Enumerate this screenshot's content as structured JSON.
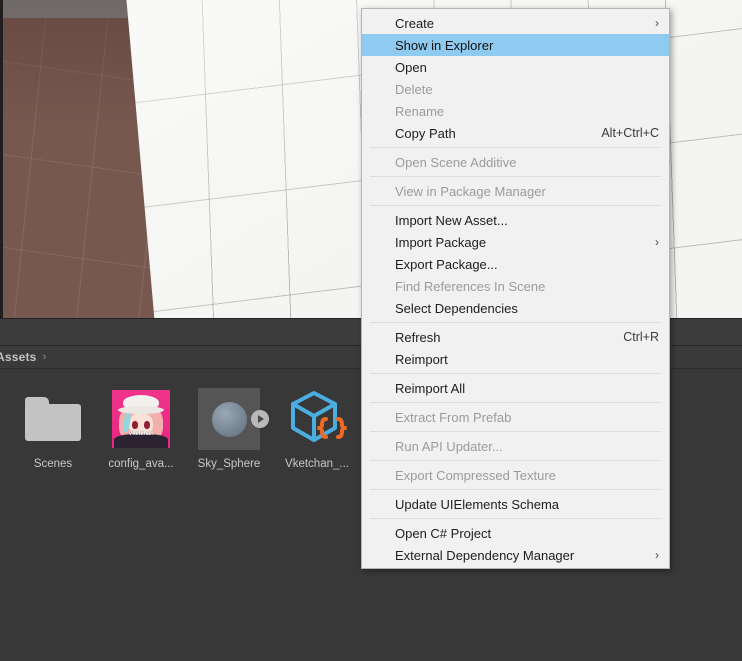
{
  "scene_view": {
    "name": "scene-viewport",
    "ground_color": "#77584f",
    "plane_color": "#f4f4f2",
    "sky_color": "#6e6a68"
  },
  "project_window": {
    "breadcrumb": {
      "root_label": "Assets",
      "chevron": "›"
    },
    "assets": [
      {
        "label": "Scenes",
        "icon": "folder-icon"
      },
      {
        "label": "config_ava...",
        "icon": "avatar-thumbnail-icon"
      },
      {
        "label": "Sky_Sphere",
        "icon": "material-preview-icon"
      },
      {
        "label": "Vketchan_...",
        "icon": "model-cube-icon"
      }
    ],
    "avatar_watermark": "Vketchan"
  },
  "context_menu": {
    "name": "project-context-menu",
    "highlight_color": "#8fcbf0",
    "background_color": "#f1f1f1",
    "items": [
      {
        "label": "Create",
        "shortcut": "",
        "submenu": true,
        "disabled": false,
        "selected": false,
        "separator_after": false
      },
      {
        "label": "Show in Explorer",
        "shortcut": "",
        "submenu": false,
        "disabled": false,
        "selected": true,
        "separator_after": false
      },
      {
        "label": "Open",
        "shortcut": "",
        "submenu": false,
        "disabled": false,
        "selected": false,
        "separator_after": false
      },
      {
        "label": "Delete",
        "shortcut": "",
        "submenu": false,
        "disabled": true,
        "selected": false,
        "separator_after": false
      },
      {
        "label": "Rename",
        "shortcut": "",
        "submenu": false,
        "disabled": true,
        "selected": false,
        "separator_after": false
      },
      {
        "label": "Copy Path",
        "shortcut": "Alt+Ctrl+C",
        "submenu": false,
        "disabled": false,
        "selected": false,
        "separator_after": true
      },
      {
        "label": "Open Scene Additive",
        "shortcut": "",
        "submenu": false,
        "disabled": true,
        "selected": false,
        "separator_after": true
      },
      {
        "label": "View in Package Manager",
        "shortcut": "",
        "submenu": false,
        "disabled": true,
        "selected": false,
        "separator_after": true
      },
      {
        "label": "Import New Asset...",
        "shortcut": "",
        "submenu": false,
        "disabled": false,
        "selected": false,
        "separator_after": false
      },
      {
        "label": "Import Package",
        "shortcut": "",
        "submenu": true,
        "disabled": false,
        "selected": false,
        "separator_after": false
      },
      {
        "label": "Export Package...",
        "shortcut": "",
        "submenu": false,
        "disabled": false,
        "selected": false,
        "separator_after": false
      },
      {
        "label": "Find References In Scene",
        "shortcut": "",
        "submenu": false,
        "disabled": true,
        "selected": false,
        "separator_after": false
      },
      {
        "label": "Select Dependencies",
        "shortcut": "",
        "submenu": false,
        "disabled": false,
        "selected": false,
        "separator_after": true
      },
      {
        "label": "Refresh",
        "shortcut": "Ctrl+R",
        "submenu": false,
        "disabled": false,
        "selected": false,
        "separator_after": false
      },
      {
        "label": "Reimport",
        "shortcut": "",
        "submenu": false,
        "disabled": false,
        "selected": false,
        "separator_after": true
      },
      {
        "label": "Reimport All",
        "shortcut": "",
        "submenu": false,
        "disabled": false,
        "selected": false,
        "separator_after": true
      },
      {
        "label": "Extract From Prefab",
        "shortcut": "",
        "submenu": false,
        "disabled": true,
        "selected": false,
        "separator_after": true
      },
      {
        "label": "Run API Updater...",
        "shortcut": "",
        "submenu": false,
        "disabled": true,
        "selected": false,
        "separator_after": true
      },
      {
        "label": "Export Compressed Texture",
        "shortcut": "",
        "submenu": false,
        "disabled": true,
        "selected": false,
        "separator_after": true
      },
      {
        "label": "Update UIElements Schema",
        "shortcut": "",
        "submenu": false,
        "disabled": false,
        "selected": false,
        "separator_after": true
      },
      {
        "label": "Open C# Project",
        "shortcut": "",
        "submenu": false,
        "disabled": false,
        "selected": false,
        "separator_after": false
      },
      {
        "label": "External Dependency Manager",
        "shortcut": "",
        "submenu": true,
        "disabled": false,
        "selected": false,
        "separator_after": false
      }
    ]
  }
}
